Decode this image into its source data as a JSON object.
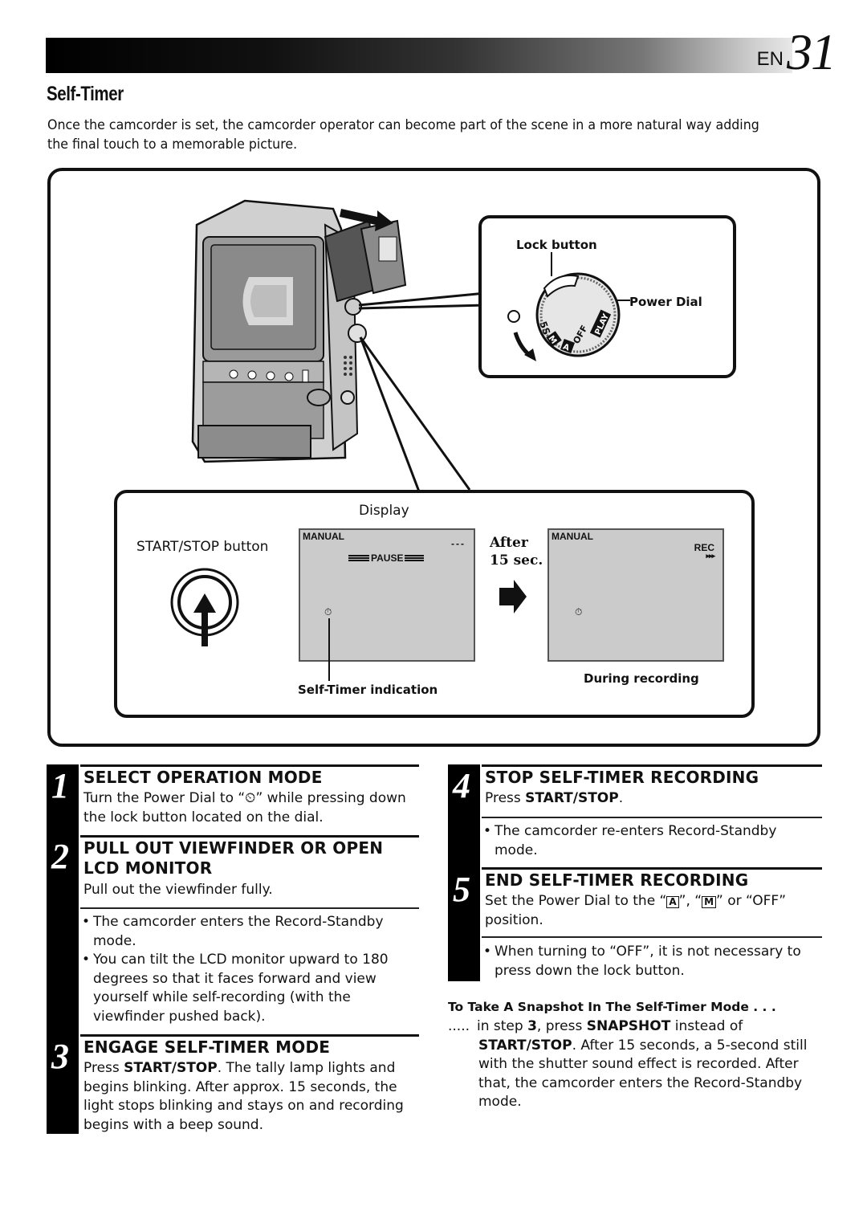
{
  "header": {
    "lang": "EN",
    "page_number": "31"
  },
  "title": "Self-Timer",
  "intro": "Once the camcorder is set, the camcorder operator can become part of the scene in a more natural way adding the final touch to a memorable picture.",
  "illustration": {
    "lock_button_label": "Lock button",
    "power_dial_label": "Power Dial",
    "dial_positions": [
      "5S",
      "M",
      "A",
      "OFF",
      "PLAY"
    ],
    "display_label": "Display",
    "start_stop_label": "START/STOP button",
    "after_label_1": "After",
    "after_label_2": "15 sec.",
    "self_timer_indication_label": "Self-Timer indication",
    "during_recording_label": "During recording",
    "screen_before": {
      "mode": "MANUAL",
      "counter": "---",
      "status": "PAUSE"
    },
    "screen_after": {
      "mode": "MANUAL",
      "status": "REC",
      "arrows": "▸▸▸"
    }
  },
  "steps": [
    {
      "number": "1",
      "heading": "SELECT OPERATION MODE",
      "body": "Turn the Power Dial to “⏲” while pressing down the lock button located on the dial.",
      "notes": []
    },
    {
      "number": "2",
      "heading_line1": "PULL OUT VIEWFINDER OR OPEN",
      "heading_line2": "LCD MONITOR",
      "body": "Pull out the viewfinder fully.",
      "notes": [
        "The camcorder enters the Record-Standby mode.",
        "You can tilt the LCD monitor upward to 180 degrees so that it faces forward and view yourself while self-recording (with the viewfinder pushed back)."
      ]
    },
    {
      "number": "3",
      "heading": "ENGAGE SELF-TIMER MODE",
      "body_pre": "Press ",
      "body_bold": "START/STOP",
      "body_post": ". The tally lamp lights and begins blinking. After approx. 15 seconds, the light stops blinking and stays on and recording begins with a beep sound."
    },
    {
      "number": "4",
      "heading": "STOP SELF-TIMER RECORDING",
      "body_pre": "Press ",
      "body_bold": "START/STOP",
      "body_post": ".",
      "notes": [
        "The camcorder re-enters Record-Standby mode."
      ]
    },
    {
      "number": "5",
      "heading": "END SELF-TIMER RECORDING",
      "body_pre": "Set the Power Dial to the “",
      "icon_a": "A",
      "body_mid": "”, “",
      "icon_m": "M",
      "body_post": "” or “OFF” position.",
      "notes": [
        "When turning to “OFF”, it is not necessary to press down the lock button."
      ]
    }
  ],
  "snapshot_tip": {
    "heading": "To Take A Snapshot In The Self-Timer Mode . . .",
    "leader": ".....",
    "t1": " in step ",
    "b1": "3",
    "t2": ", press ",
    "b2": "SNAPSHOT",
    "t3": " instead of ",
    "b3": "START/STOP",
    "t4": ". After 15 seconds, a 5-second still with the shutter sound effect is recorded. After that, the camcorder enters the Record-Standby mode."
  }
}
